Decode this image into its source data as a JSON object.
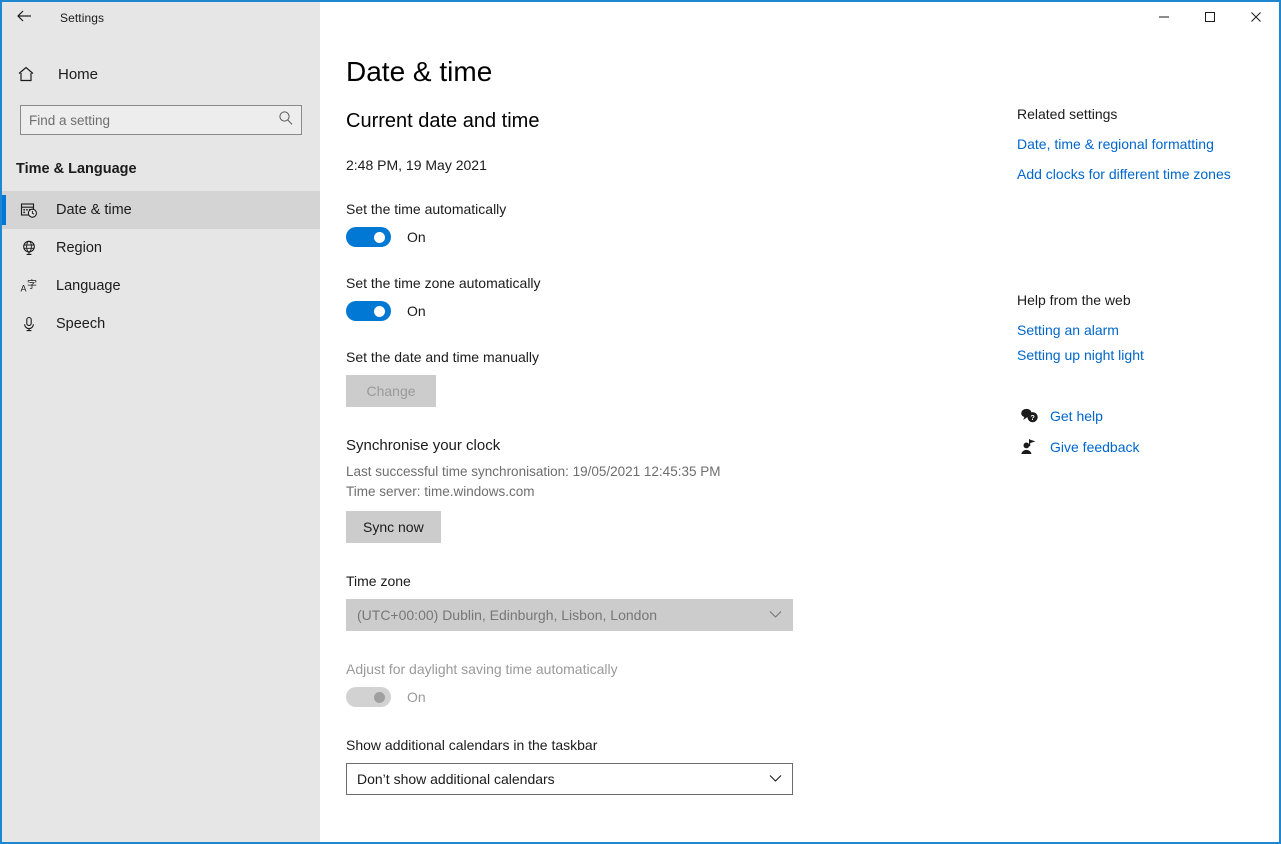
{
  "window": {
    "title": "Settings",
    "back_label": "back-arrow",
    "controls": {
      "minimize": "Minimise",
      "maximize": "Maximise",
      "close": "Close"
    },
    "accent_color": "#0078d7",
    "border_color": "#1f86d0"
  },
  "sidebar": {
    "home_label": "Home",
    "search": {
      "placeholder": "Find a setting",
      "value": ""
    },
    "category": "Time & Language",
    "items": [
      {
        "label": "Date & time",
        "icon": "calendar-clock-icon",
        "selected": true
      },
      {
        "label": "Region",
        "icon": "globe-icon",
        "selected": false
      },
      {
        "label": "Language",
        "icon": "language-icon",
        "selected": false
      },
      {
        "label": "Speech",
        "icon": "microphone-icon",
        "selected": false
      }
    ]
  },
  "main": {
    "page_title": "Date & time",
    "current_heading": "Current date and time",
    "current_value": "2:48 PM, 19 May 2021",
    "set_time_auto": {
      "label": "Set the time automatically",
      "state": "On",
      "enabled": true
    },
    "set_timezone_auto": {
      "label": "Set the time zone automatically",
      "state": "On",
      "enabled": true
    },
    "set_manually": {
      "label": "Set the date and time manually",
      "button": "Change",
      "button_enabled": false
    },
    "sync": {
      "heading": "Synchronise your clock",
      "last_sync": "Last successful time synchronisation: 19/05/2021 12:45:35 PM",
      "server": "Time server: time.windows.com",
      "button": "Sync now",
      "button_enabled": true
    },
    "timezone": {
      "label": "Time zone",
      "value": "(UTC+00:00) Dublin, Edinburgh, Lisbon, London",
      "enabled": false
    },
    "dst": {
      "label": "Adjust for daylight saving time automatically",
      "state": "On",
      "enabled": false
    },
    "calendars": {
      "label": "Show additional calendars in the taskbar",
      "value": "Don’t show additional calendars",
      "enabled": true
    }
  },
  "right": {
    "related_heading": "Related settings",
    "related_links": [
      "Date, time & regional formatting",
      "Add clocks for different time zones"
    ],
    "help_heading": "Help from the web",
    "help_links": [
      "Setting an alarm",
      "Setting up night light"
    ],
    "support": [
      {
        "label": "Get help",
        "icon": "help-bubble-icon"
      },
      {
        "label": "Give feedback",
        "icon": "feedback-person-icon"
      }
    ]
  }
}
